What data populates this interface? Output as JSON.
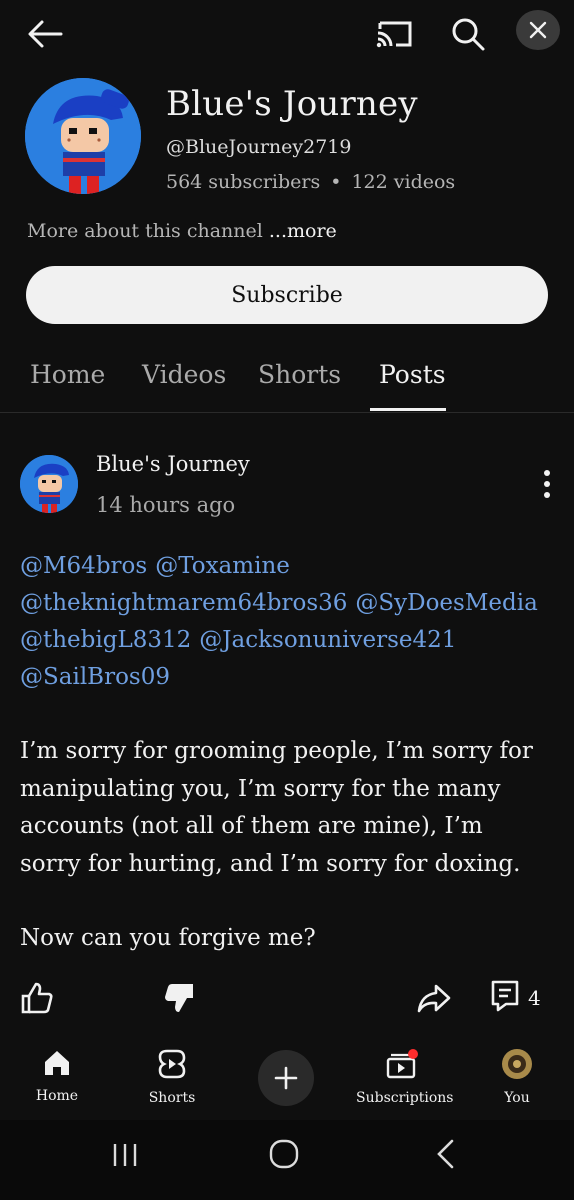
{
  "channel": {
    "name": "Blue's Journey",
    "handle": "@BlueJourney2719",
    "subscribers": "564 subscribers",
    "dot": "•",
    "videos": "122 videos",
    "more_about": "More about this channel",
    "more_link": "...more",
    "subscribe_label": "Subscribe"
  },
  "tabs": [
    {
      "label": "Home"
    },
    {
      "label": "Videos"
    },
    {
      "label": "Shorts"
    },
    {
      "label": "Posts"
    }
  ],
  "post": {
    "author": "Blue's Journey",
    "time": "14 hours ago",
    "mentions": [
      "@M64bros",
      "@Toxamine",
      "@theknightmarem64bros36",
      "@SyDoesMedia",
      "@thebigL8312",
      "@Jacksonuniverse421",
      "@SailBros09"
    ],
    "paragraph1": "I’m sorry for grooming people, I’m sorry for manipulating you, I’m sorry for the many accounts (not all of them are mine), I’m sorry for hurting, and I’m sorry for doxing.",
    "paragraph2": "Now can you forgive me?",
    "comment_count": "4"
  },
  "bottom_nav": {
    "home": "Home",
    "shorts": "Shorts",
    "subscriptions": "Subscriptions",
    "you": "You"
  },
  "colors": {
    "background": "#0f0f0f",
    "mention": "#6f9fe0",
    "avatar_blue": "#2b7fe0",
    "notification_red": "#ff2d2d"
  },
  "icons": [
    "back-arrow-icon",
    "cast-icon",
    "search-icon",
    "close-icon",
    "like-icon",
    "dislike-icon",
    "share-icon",
    "comment-icon",
    "home-icon",
    "shorts-icon",
    "plus-icon",
    "subscriptions-icon",
    "you-avatar-icon",
    "recents-icon",
    "home-circle-icon",
    "back-chevron-icon"
  ]
}
